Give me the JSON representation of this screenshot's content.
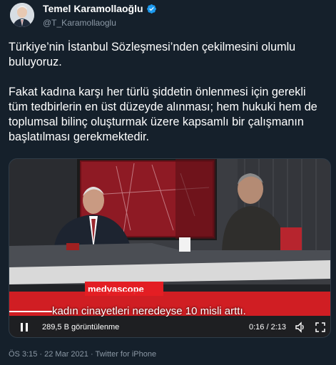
{
  "author": {
    "display_name": "Temel Karamollaoğlu",
    "handle": "@T_Karamollaoglu",
    "verified": true
  },
  "tweet": {
    "paragraph_1": "Türkiye’nin İstanbul Sözleşmesi’nden çekilmesini olumlu buluyoruz.",
    "paragraph_2": "Fakat kadına karşı her türlü şiddetin önlenmesi için gerekli tüm tedbirlerin en üst düzeyde alınması; hem hukuki hem de toplumsal bilinç oluşturmak üzere kapsamlı bir çalışmanın başlatılması gerekmektedir."
  },
  "video": {
    "logo_text": "medyascope",
    "caption": "kadın cinayetleri neredeyse 10 misli arttı.",
    "views": "289,5 B görüntülenme",
    "time": "0:16 / 2:13",
    "play_icon": "pause-icon",
    "volume_icon": "volume-icon",
    "fullscreen_icon": "fullscreen-icon"
  },
  "meta": {
    "timestamp": "ÖS 3:15 · 22 Mar 2021 · Twitter for iPhone"
  },
  "colors": {
    "background": "#15202b",
    "text": "#ffffff",
    "muted": "#8b98a5",
    "verified": "#1d9bf0",
    "logo_red": "#e31e24"
  }
}
